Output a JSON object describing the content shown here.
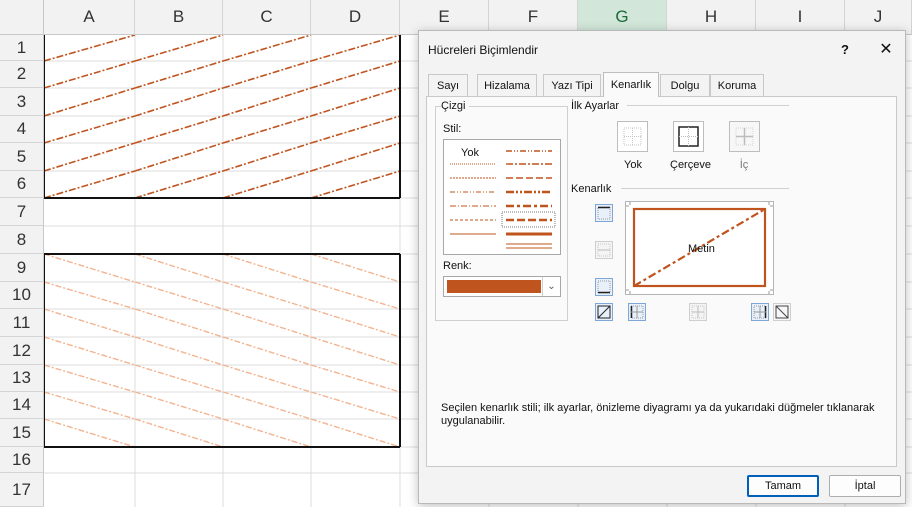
{
  "spreadsheet": {
    "columns": [
      "A",
      "B",
      "C",
      "D",
      "E",
      "F",
      "G",
      "H",
      "I",
      "J"
    ],
    "selected_column": "G",
    "rows": [
      "1",
      "2",
      "3",
      "4",
      "5",
      "6",
      "7",
      "8",
      "9",
      "10",
      "11",
      "12",
      "13",
      "14",
      "15",
      "16",
      "17"
    ]
  },
  "dialog": {
    "title": "Hücreleri Biçimlendir",
    "help": "?",
    "close": "✕",
    "tabs": [
      "Sayı",
      "Hizalama",
      "Yazı Tipi",
      "Kenarlık",
      "Dolgu",
      "Koruma"
    ],
    "active_tab": "Kenarlık",
    "line_group": {
      "title": "Çizgi",
      "style_label": "Stil:",
      "none_option": "Yok",
      "color_label": "Renk:",
      "color_value": "#c0541f"
    },
    "presets": {
      "title": "İlk Ayarlar",
      "items": [
        "Yok",
        "Çerçeve",
        "İç"
      ]
    },
    "border": {
      "title": "Kenarlık",
      "preview_text": "Metin"
    },
    "description": "Seçilen kenarlık stili; ilk ayarlar, önizleme diyagramı ya da yukarıdaki düğmeler tıklanarak uygulanabilir.",
    "ok_label": "Tamam",
    "cancel_label": "İptal"
  },
  "colors": {
    "dark_border": "#c0541f",
    "light_border": "#f2b491",
    "selected_header": "#217346"
  }
}
